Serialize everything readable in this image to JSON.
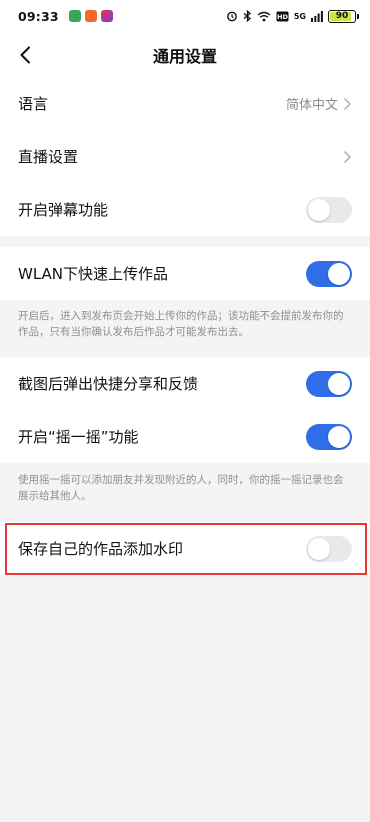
{
  "status_bar": {
    "time": "09:33",
    "signal_label": "5G",
    "battery": "90",
    "battery_level": 0.9
  },
  "header": {
    "title": "通用设置",
    "back_icon": "chevron-left-icon"
  },
  "settings": {
    "language": {
      "label": "语言",
      "value": "简体中文"
    },
    "live": {
      "label": "直播设置"
    },
    "danmaku": {
      "label": "开启弹幕功能",
      "enabled": false
    },
    "wlan_upload": {
      "label": "WLAN下快速上传作品",
      "enabled": true,
      "description": "开启后，进入到发布页会开始上传你的作品；该功能不会提前发布你的作品，只有当你确认发布后作品才可能发布出去。"
    },
    "screenshot_share": {
      "label": "截图后弹出快捷分享和反馈",
      "enabled": true
    },
    "shake": {
      "label": "开启“摇一摇”功能",
      "enabled": true,
      "description": "使用摇一摇可以添加朋友并发现附近的人，同时，你的摇一摇记录也会展示给其他人。"
    },
    "watermark": {
      "label": "保存自己的作品添加水印",
      "enabled": false
    }
  },
  "colors": {
    "accent": "#2f6ee6",
    "highlight": "#e53935",
    "background": "#f4f4f5"
  }
}
